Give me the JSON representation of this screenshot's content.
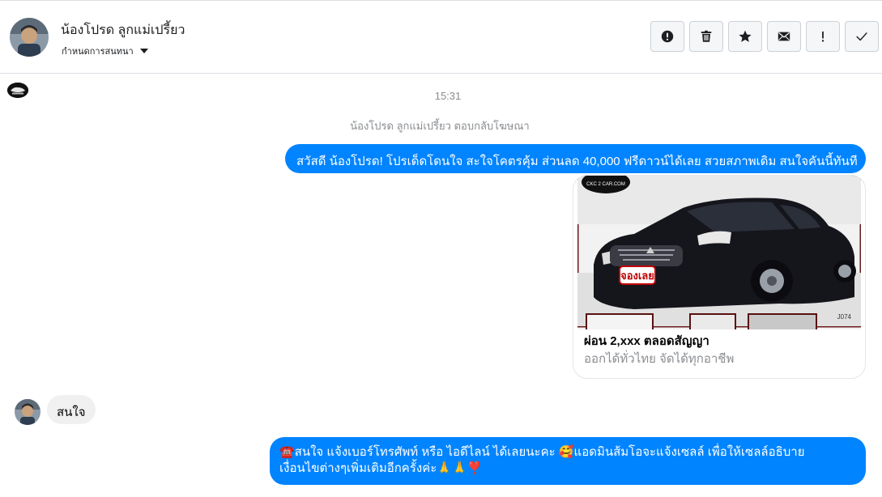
{
  "contact": {
    "name": "น้องโปรด ลูกแม่เปรี้ยว",
    "assign_label": "กำหนดการสนทนา"
  },
  "toolbar": {
    "buttons": [
      {
        "name": "report-spam-button",
        "icon": "exclamation-circle-icon"
      },
      {
        "name": "delete-button",
        "icon": "trash-icon"
      },
      {
        "name": "star-button",
        "icon": "star-icon"
      },
      {
        "name": "mark-unread-button",
        "icon": "envelope-icon"
      },
      {
        "name": "important-button",
        "icon": "exclamation-icon"
      },
      {
        "name": "mark-done-button",
        "icon": "checkmark-icon"
      }
    ]
  },
  "conversation": {
    "timestamp": "15:31",
    "system_note": "น้องโปรด ลูกแม่เปรี้ยว ตอบกลับโฆษณา",
    "outgoing_1": "สวัสดี น้องโปรด! โปรเด็ดโดนใจ สะใจโคตรคุ้ม ส่วนลด 40,000 ฟรีดาวน์ได้เลย สวยสภาพเดิม สนใจคันนี้ทันที",
    "card": {
      "image_watermark": "CKC 2 CAR.COM",
      "image_sticker": "จองเลย",
      "image_code": "J074",
      "title": "ผ่อน 2,xxx ตลอดสัญญา",
      "subtitle": "ออกได้ทั่วไทย จัดได้ทุกอาชีพ"
    },
    "incoming_1": "สนใจ",
    "outgoing_2_line1": "☎️สนใจ แจ้งเบอร์โทรศัพท์ หรือ ไอดีไลน์  ได้เลยนะคะ 🥰แอดมินส้มโอจะแจ้งเซลล์     เพื่อให้เซลล์อธิบาย",
    "outgoing_2_line2": "เงื่อนไขต่างๆเพิ่มเติมอีกครั้งค่ะ🙏🙏❣️"
  },
  "colors": {
    "outgoing_bubble": "#0084ff",
    "incoming_bubble": "#f0f0f0",
    "muted_text": "#8a8d91"
  }
}
